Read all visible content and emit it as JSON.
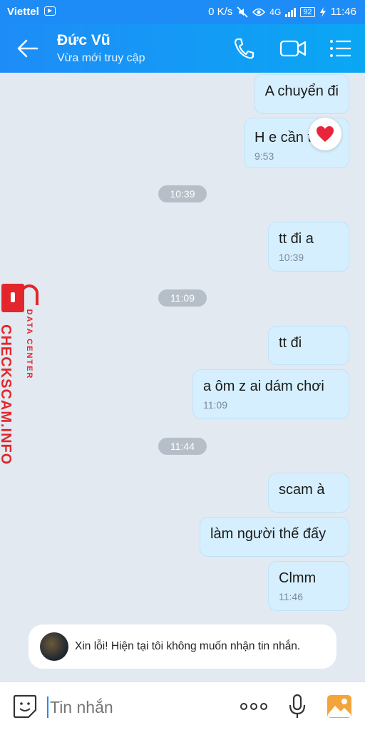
{
  "status_bar": {
    "carrier": "Viettel",
    "network_speed": "0 K/s",
    "network_type": "4G",
    "battery": "92",
    "time": "11:46"
  },
  "header": {
    "title": "Đức Vũ",
    "subtitle": "Vừa mới truy cập"
  },
  "messages": [
    {
      "text": "A chuyển đi",
      "time": ""
    },
    {
      "text": "H e cần tiền",
      "time": "9:53",
      "reaction": "heart-icon"
    },
    {
      "divider": "10:39"
    },
    {
      "text": "tt đi a",
      "time": "10:39"
    },
    {
      "divider": "11:09"
    },
    {
      "text": "tt đi",
      "time": ""
    },
    {
      "text": "a ôm z ai dám chơi",
      "time": "11:09"
    },
    {
      "divider": "11:44"
    },
    {
      "text": "scam à",
      "time": ""
    },
    {
      "text": "làm người thế đấy",
      "time": ""
    },
    {
      "text": "Clmm",
      "time": "11:46"
    }
  ],
  "watermark": {
    "main": "CHECKSCAM.INFO",
    "sub": "DATA CENTER"
  },
  "notice": {
    "text": "Xin lỗi! Hiện tại tôi không muốn nhận tin nhắn."
  },
  "input": {
    "placeholder": "Tin nhắn"
  },
  "colors": {
    "accent": "#1e8cf7",
    "bubble": "#d5effe",
    "background": "#e2e9f1",
    "watermark": "#e3262b"
  }
}
